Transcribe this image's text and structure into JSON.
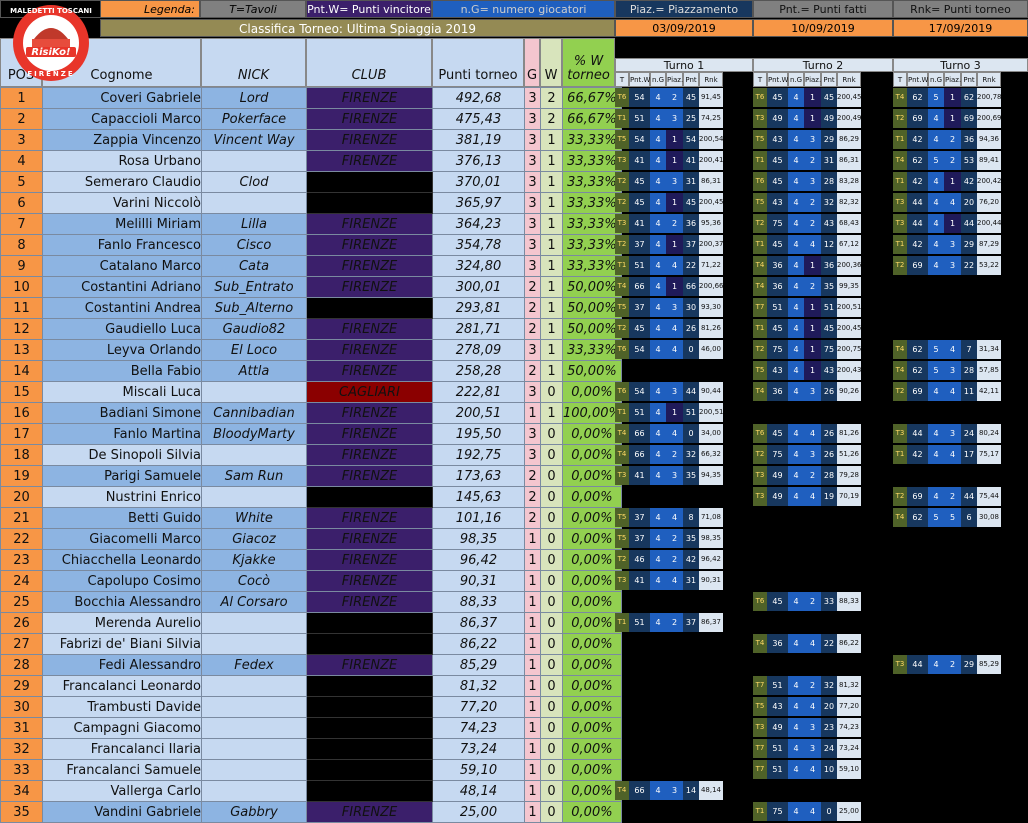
{
  "legend": {
    "label": "Legenda:",
    "t": "T=Tavoli",
    "pntw": "Pnt.W= Punti vincitore",
    "ng": "n.G= numero giocatori",
    "piaz": "Piaz.= Piazzamento",
    "pnt": "Pnt.= Punti fatti",
    "rnk": "Rnk= Punti torneo"
  },
  "title": "Classifica Torneo: Ultima Spiaggia 2019",
  "dates": [
    "03/09/2019",
    "10/09/2019",
    "17/09/2019"
  ],
  "logo": {
    "top": "MALEDETTI TOSCANI",
    "brand": "RisiKo!",
    "sub": "OFFICIAL CLUB",
    "bottom": "FIRENZE"
  },
  "headers": {
    "pos": "POS",
    "cognome": "Cognome",
    "nick": "NICK",
    "club": "CLUB",
    "punti": "Punti torneo",
    "g": "G",
    "w": "W",
    "pct": "% W torneo"
  },
  "turni": [
    "Turno 1",
    "Turno 2",
    "Turno 3"
  ],
  "turno_cols": [
    "T",
    "Pnt.W",
    "n.G",
    "Piaz.",
    "Pnt",
    "Rnk"
  ],
  "rows": [
    {
      "pos": "1",
      "name": "Coveri Gabriele",
      "nick": "Lord",
      "club": "FIRENZE",
      "pts": "492,68",
      "g": "3",
      "w": "2",
      "pct": "66,67%"
    },
    {
      "pos": "2",
      "name": "Capaccioli Marco",
      "nick": "Pokerface",
      "club": "FIRENZE",
      "pts": "475,43",
      "g": "3",
      "w": "2",
      "pct": "66,67%"
    },
    {
      "pos": "3",
      "name": "Zappia Vincenzo",
      "nick": "Vincent Way",
      "club": "FIRENZE",
      "pts": "381,19",
      "g": "3",
      "w": "1",
      "pct": "33,33%"
    },
    {
      "pos": "4",
      "name": "Rosa Urbano",
      "nick": "",
      "club": "FIRENZE",
      "pts": "376,13",
      "g": "3",
      "w": "1",
      "pct": "33,33%"
    },
    {
      "pos": "5",
      "name": "Semeraro Claudio",
      "nick": "Clod",
      "club": "",
      "pts": "370,01",
      "g": "3",
      "w": "1",
      "pct": "33,33%"
    },
    {
      "pos": "6",
      "name": "Varini Niccolò",
      "nick": "",
      "club": "",
      "pts": "365,97",
      "g": "3",
      "w": "1",
      "pct": "33,33%"
    },
    {
      "pos": "7",
      "name": "Melilli Miriam",
      "nick": "Lilla",
      "club": "FIRENZE",
      "pts": "364,23",
      "g": "3",
      "w": "1",
      "pct": "33,33%"
    },
    {
      "pos": "8",
      "name": "Fanlo Francesco",
      "nick": "Cisco",
      "club": "FIRENZE",
      "pts": "354,78",
      "g": "3",
      "w": "1",
      "pct": "33,33%"
    },
    {
      "pos": "9",
      "name": "Catalano Marco",
      "nick": "Cata",
      "club": "FIRENZE",
      "pts": "324,80",
      "g": "3",
      "w": "1",
      "pct": "33,33%"
    },
    {
      "pos": "10",
      "name": "Costantini Adriano",
      "nick": "Sub_Entrato",
      "club": "FIRENZE",
      "pts": "300,01",
      "g": "2",
      "w": "1",
      "pct": "50,00%"
    },
    {
      "pos": "11",
      "name": "Costantini Andrea",
      "nick": "Sub_Alterno",
      "club": "",
      "pts": "293,81",
      "g": "2",
      "w": "1",
      "pct": "50,00%"
    },
    {
      "pos": "12",
      "name": "Gaudiello Luca",
      "nick": "Gaudio82",
      "club": "FIRENZE",
      "pts": "281,71",
      "g": "2",
      "w": "1",
      "pct": "50,00%"
    },
    {
      "pos": "13",
      "name": "Leyva Orlando",
      "nick": "El Loco",
      "club": "FIRENZE",
      "pts": "278,09",
      "g": "3",
      "w": "1",
      "pct": "33,33%"
    },
    {
      "pos": "14",
      "name": "Bella Fabio",
      "nick": "Attla",
      "club": "FIRENZE",
      "pts": "258,28",
      "g": "2",
      "w": "1",
      "pct": "50,00%"
    },
    {
      "pos": "15",
      "name": "Miscali Luca",
      "nick": "",
      "club": "CAGLIARI",
      "pts": "222,81",
      "g": "3",
      "w": "0",
      "pct": "0,00%"
    },
    {
      "pos": "16",
      "name": "Badiani Simone",
      "nick": "Cannibadian",
      "club": "FIRENZE",
      "pts": "200,51",
      "g": "1",
      "w": "1",
      "pct": "100,00%"
    },
    {
      "pos": "17",
      "name": "Fanlo Martina",
      "nick": "BloodyMarty",
      "club": "FIRENZE",
      "pts": "195,50",
      "g": "3",
      "w": "0",
      "pct": "0,00%"
    },
    {
      "pos": "18",
      "name": "De Sinopoli Silvia",
      "nick": "",
      "club": "FIRENZE",
      "pts": "192,75",
      "g": "3",
      "w": "0",
      "pct": "0,00%"
    },
    {
      "pos": "19",
      "name": "Parigi Samuele",
      "nick": "Sam Run",
      "club": "FIRENZE",
      "pts": "173,63",
      "g": "2",
      "w": "0",
      "pct": "0,00%"
    },
    {
      "pos": "20",
      "name": "Nustrini Enrico",
      "nick": "",
      "club": "",
      "pts": "145,63",
      "g": "2",
      "w": "0",
      "pct": "0,00%"
    },
    {
      "pos": "21",
      "name": "Betti Guido",
      "nick": "White",
      "club": "FIRENZE",
      "pts": "101,16",
      "g": "2",
      "w": "0",
      "pct": "0,00%"
    },
    {
      "pos": "22",
      "name": "Giacomelli Marco",
      "nick": "Giacoz",
      "club": "FIRENZE",
      "pts": "98,35",
      "g": "1",
      "w": "0",
      "pct": "0,00%"
    },
    {
      "pos": "23",
      "name": "Chiacchella Leonardo",
      "nick": "Kjakke",
      "club": "FIRENZE",
      "pts": "96,42",
      "g": "1",
      "w": "0",
      "pct": "0,00%"
    },
    {
      "pos": "24",
      "name": "Capolupo Cosimo",
      "nick": "Cocò",
      "club": "FIRENZE",
      "pts": "90,31",
      "g": "1",
      "w": "0",
      "pct": "0,00%"
    },
    {
      "pos": "25",
      "name": "Bocchia Alessandro",
      "nick": "Al Corsaro",
      "club": "FIRENZE",
      "pts": "88,33",
      "g": "1",
      "w": "0",
      "pct": "0,00%"
    },
    {
      "pos": "26",
      "name": "Merenda Aurelio",
      "nick": "",
      "club": "",
      "pts": "86,37",
      "g": "1",
      "w": "0",
      "pct": "0,00%"
    },
    {
      "pos": "27",
      "name": "Fabrizi de' Biani Silvia",
      "nick": "",
      "club": "",
      "pts": "86,22",
      "g": "1",
      "w": "0",
      "pct": "0,00%"
    },
    {
      "pos": "28",
      "name": "Fedi Alessandro",
      "nick": "Fedex",
      "club": "FIRENZE",
      "pts": "85,29",
      "g": "1",
      "w": "0",
      "pct": "0,00%"
    },
    {
      "pos": "29",
      "name": "Francalanci Leonardo",
      "nick": "",
      "club": "",
      "pts": "81,32",
      "g": "1",
      "w": "0",
      "pct": "0,00%"
    },
    {
      "pos": "30",
      "name": "Trambusti Davide",
      "nick": "",
      "club": "",
      "pts": "77,20",
      "g": "1",
      "w": "0",
      "pct": "0,00%"
    },
    {
      "pos": "31",
      "name": "Campagni Giacomo",
      "nick": "",
      "club": "",
      "pts": "74,23",
      "g": "1",
      "w": "0",
      "pct": "0,00%"
    },
    {
      "pos": "32",
      "name": "Francalanci Ilaria",
      "nick": "",
      "club": "",
      "pts": "73,24",
      "g": "1",
      "w": "0",
      "pct": "0,00%"
    },
    {
      "pos": "33",
      "name": "Francalanci Samuele",
      "nick": "",
      "club": "",
      "pts": "59,10",
      "g": "1",
      "w": "0",
      "pct": "0,00%"
    },
    {
      "pos": "34",
      "name": "Vallerga Carlo",
      "nick": "",
      "club": "",
      "pts": "48,14",
      "g": "1",
      "w": "0",
      "pct": "0,00%"
    },
    {
      "pos": "35",
      "name": "Vandini Gabriele",
      "nick": "Gabbry",
      "club": "FIRENZE",
      "pts": "25,00",
      "g": "1",
      "w": "0",
      "pct": "0,00%"
    }
  ],
  "turno_data": [
    [
      [
        "T6",
        "54",
        "4",
        "2",
        "45",
        "91,45"
      ],
      [
        "T1",
        "51",
        "4",
        "3",
        "25",
        "74,25"
      ],
      [
        "T5",
        "54",
        "4",
        "1",
        "54",
        "200,54"
      ],
      [
        "T3",
        "41",
        "4",
        "1",
        "41",
        "200,41"
      ],
      [
        "T2",
        "45",
        "4",
        "3",
        "31",
        "86,31"
      ],
      [
        "T2",
        "45",
        "4",
        "1",
        "45",
        "200,45"
      ],
      [
        "T3",
        "41",
        "4",
        "2",
        "36",
        "95,36"
      ],
      [
        "T2",
        "37",
        "4",
        "1",
        "37",
        "200,37"
      ],
      [
        "T1",
        "51",
        "4",
        "4",
        "22",
        "71,22"
      ],
      [
        "T4",
        "66",
        "4",
        "1",
        "66",
        "200,66"
      ],
      [
        "T5",
        "37",
        "4",
        "3",
        "30",
        "93,30"
      ],
      [
        "T2",
        "45",
        "4",
        "4",
        "26",
        "81,26"
      ],
      [
        "T6",
        "54",
        "4",
        "4",
        "0",
        "46,00"
      ],
      null,
      [
        "T6",
        "54",
        "4",
        "3",
        "44",
        "90,44"
      ],
      [
        "T1",
        "51",
        "4",
        "1",
        "51",
        "200,51"
      ],
      [
        "T4",
        "66",
        "4",
        "4",
        "0",
        "34,00"
      ],
      [
        "T4",
        "66",
        "4",
        "2",
        "32",
        "66,32"
      ],
      [
        "T3",
        "41",
        "4",
        "3",
        "35",
        "94,35"
      ],
      null,
      [
        "T5",
        "37",
        "4",
        "4",
        "8",
        "71,08"
      ],
      [
        "T5",
        "37",
        "4",
        "2",
        "35",
        "98,35"
      ],
      [
        "T2",
        "46",
        "4",
        "2",
        "42",
        "96,42"
      ],
      [
        "T3",
        "41",
        "4",
        "4",
        "31",
        "90,31"
      ],
      null,
      [
        "T1",
        "51",
        "4",
        "2",
        "37",
        "86,37"
      ],
      null,
      null,
      null,
      null,
      null,
      null,
      null,
      [
        "T4",
        "66",
        "4",
        "3",
        "14",
        "48,14"
      ],
      null
    ],
    [
      [
        "T6",
        "45",
        "4",
        "1",
        "45",
        "200,45"
      ],
      [
        "T3",
        "49",
        "4",
        "1",
        "49",
        "200,49"
      ],
      [
        "T5",
        "43",
        "4",
        "3",
        "29",
        "86,29"
      ],
      [
        "T1",
        "45",
        "4",
        "2",
        "31",
        "86,31"
      ],
      [
        "T6",
        "45",
        "4",
        "3",
        "28",
        "83,28"
      ],
      [
        "T5",
        "43",
        "4",
        "2",
        "32",
        "82,32"
      ],
      [
        "T2",
        "75",
        "4",
        "2",
        "43",
        "68,43"
      ],
      [
        "T1",
        "45",
        "4",
        "4",
        "12",
        "67,12"
      ],
      [
        "T4",
        "36",
        "4",
        "1",
        "36",
        "200,36"
      ],
      [
        "T4",
        "36",
        "4",
        "2",
        "35",
        "99,35"
      ],
      [
        "T7",
        "51",
        "4",
        "1",
        "51",
        "200,51"
      ],
      [
        "T1",
        "45",
        "4",
        "1",
        "45",
        "200,45"
      ],
      [
        "T2",
        "75",
        "4",
        "1",
        "75",
        "200,75"
      ],
      [
        "T5",
        "43",
        "4",
        "1",
        "43",
        "200,43"
      ],
      [
        "T4",
        "36",
        "4",
        "3",
        "26",
        "90,26"
      ],
      null,
      [
        "T6",
        "45",
        "4",
        "4",
        "26",
        "81,26"
      ],
      [
        "T2",
        "75",
        "4",
        "3",
        "26",
        "51,26"
      ],
      [
        "T3",
        "49",
        "4",
        "2",
        "28",
        "79,28"
      ],
      [
        "T3",
        "49",
        "4",
        "4",
        "19",
        "70,19"
      ],
      null,
      null,
      null,
      null,
      [
        "T6",
        "45",
        "4",
        "2",
        "33",
        "88,33"
      ],
      null,
      [
        "T4",
        "36",
        "4",
        "4",
        "22",
        "86,22"
      ],
      null,
      [
        "T7",
        "51",
        "4",
        "2",
        "32",
        "81,32"
      ],
      [
        "T5",
        "43",
        "4",
        "4",
        "20",
        "77,20"
      ],
      [
        "T3",
        "49",
        "4",
        "3",
        "23",
        "74,23"
      ],
      [
        "T7",
        "51",
        "4",
        "3",
        "24",
        "73,24"
      ],
      [
        "T7",
        "51",
        "4",
        "4",
        "10",
        "59,10"
      ],
      null,
      [
        "T1",
        "75",
        "4",
        "4",
        "0",
        "25,00"
      ]
    ],
    [
      [
        "T4",
        "62",
        "5",
        "1",
        "62",
        "200,78"
      ],
      [
        "T2",
        "69",
        "4",
        "1",
        "69",
        "200,69"
      ],
      [
        "T1",
        "42",
        "4",
        "2",
        "36",
        "94,36"
      ],
      [
        "T4",
        "62",
        "5",
        "2",
        "53",
        "89,41"
      ],
      [
        "T1",
        "42",
        "4",
        "1",
        "42",
        "200,42"
      ],
      [
        "T3",
        "44",
        "4",
        "4",
        "20",
        "76,20"
      ],
      [
        "T3",
        "44",
        "4",
        "1",
        "44",
        "200,44"
      ],
      [
        "T1",
        "42",
        "4",
        "3",
        "29",
        "87,29"
      ],
      [
        "T2",
        "69",
        "4",
        "3",
        "22",
        "53,22"
      ],
      null,
      null,
      null,
      [
        "T4",
        "62",
        "5",
        "4",
        "7",
        "31,34"
      ],
      [
        "T4",
        "62",
        "5",
        "3",
        "28",
        "57,85"
      ],
      [
        "T2",
        "69",
        "4",
        "4",
        "11",
        "42,11"
      ],
      null,
      [
        "T3",
        "44",
        "4",
        "3",
        "24",
        "80,24"
      ],
      [
        "T1",
        "42",
        "4",
        "4",
        "17",
        "75,17"
      ],
      null,
      [
        "T2",
        "69",
        "4",
        "2",
        "44",
        "75,44"
      ],
      [
        "T4",
        "62",
        "5",
        "5",
        "6",
        "30,08"
      ],
      null,
      null,
      null,
      null,
      null,
      null,
      [
        "T3",
        "44",
        "4",
        "2",
        "29",
        "85,29"
      ],
      null,
      null,
      null,
      null,
      null,
      null,
      null
    ]
  ]
}
